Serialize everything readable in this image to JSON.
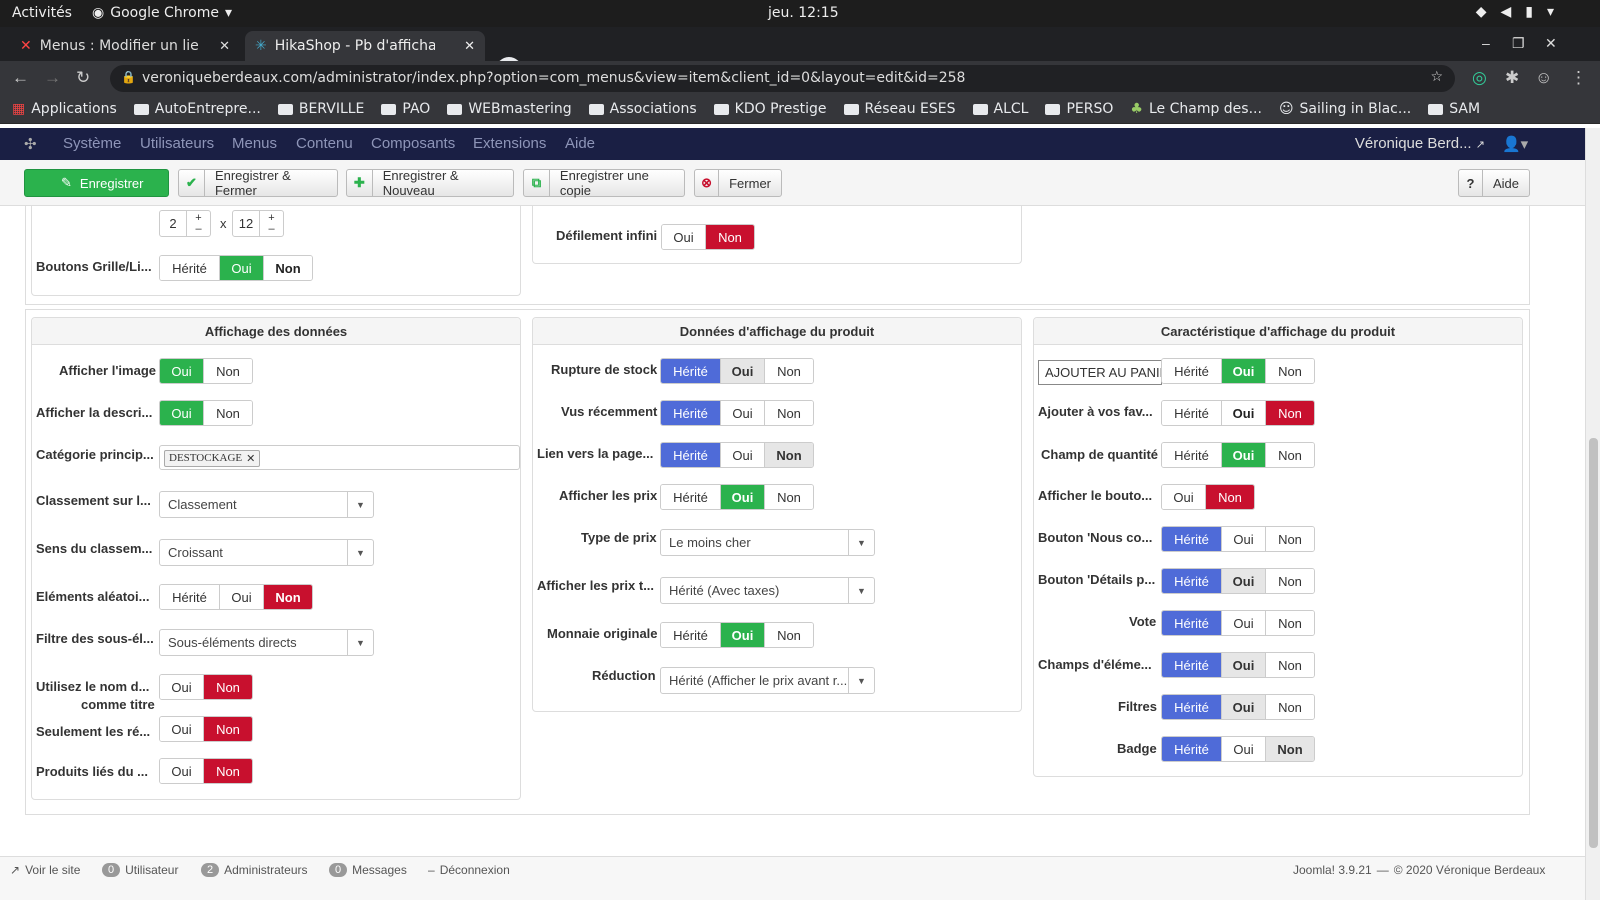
{
  "os": {
    "activities": "Activités",
    "app": "Google Chrome",
    "clock": "jeu. 12:15"
  },
  "browser": {
    "tabs": [
      {
        "title": "Menus : Modifier un lien d"
      },
      {
        "title": "HikaShop - Pb d'affichage"
      }
    ],
    "url": "veroniqueberdeaux.com/administrator/index.php?option=com_menus&view=item&client_id=0&layout=edit&id=258",
    "bookmarks": [
      "Applications",
      "AutoEntrepre...",
      "BERVILLE",
      "PAO",
      "WEBmastering",
      "Associations",
      "KDO Prestige",
      "Réseau ESES",
      "ALCL",
      "PERSO",
      "Le Champ des...",
      "Sailing in Blac...",
      "SAM"
    ]
  },
  "joomla_nav": {
    "menu": [
      "Système",
      "Utilisateurs",
      "Menus",
      "Contenu",
      "Composants",
      "Extensions",
      "Aide"
    ],
    "user": "Véronique Berd..."
  },
  "toolbar": {
    "save": "Enregistrer",
    "save_close": "Enregistrer & Fermer",
    "save_new": "Enregistrer & Nouveau",
    "save_copy": "Enregistrer une copie",
    "close": "Fermer",
    "help": "Aide"
  },
  "top": {
    "grid_cols": "2",
    "grid_rows": "12",
    "x": "x",
    "buttons_label": "Boutons Grille/Li...",
    "buttons_opts": [
      "Hérité",
      "Oui",
      "Non"
    ],
    "infinite_label": "Défilement infini",
    "infinite_opts": [
      "Oui",
      "Non"
    ]
  },
  "panel1": {
    "title": "Affichage des données",
    "show_image": "Afficher l'image",
    "show_desc": "Afficher la descri...",
    "main_cat": "Catégorie princip...",
    "main_cat_tag": "DESTOCKAGE",
    "sort_on": "Classement sur l...",
    "sort_on_val": "Classement",
    "sort_dir": "Sens du classem...",
    "sort_dir_val": "Croissant",
    "random": "Eléments aléatoi...",
    "filter": "Filtre des sous-él...",
    "filter_val": "Sous-éléments directs",
    "use_name1": "Utilisez le nom d...",
    "use_name2": "comme titre",
    "only": "Seulement les ré...",
    "related": "Produits liés du ...",
    "oui": "Oui",
    "non": "Non",
    "herite": "Hérité"
  },
  "panel2": {
    "title": "Données d'affichage du produit",
    "stock": "Rupture de stock",
    "recent": "Vus récemment",
    "link": "Lien vers la page...",
    "show_price": "Afficher les prix",
    "price_type": "Type de prix",
    "price_type_val": "Le moins cher",
    "show_prices_t": "Afficher les prix t...",
    "show_prices_t_val": "Hérité (Avec taxes)",
    "orig_currency": "Monnaie originale",
    "discount": "Réduction",
    "discount_val": "Hérité (Afficher le prix avant r..."
  },
  "panel3": {
    "title": "Caractéristique d'affichage du produit",
    "cart_input": "AJOUTER AU PANIER",
    "wishlist": "Ajouter à vos fav...",
    "qty": "Champ de quantité",
    "show_btn": "Afficher le bouto...",
    "contact": "Bouton 'Nous co...",
    "details": "Bouton 'Détails p...",
    "vote": "Vote",
    "fields": "Champs d'éléme...",
    "filters": "Filtres",
    "badge": "Badge"
  },
  "status": {
    "view_site": "Voir le site",
    "users_count": "0",
    "users": "Utilisateur",
    "admins_count": "2",
    "admins": "Administrateurs",
    "msg_count": "0",
    "messages": "Messages",
    "logout": "Déconnexion",
    "version": "Joomla! 3.9.21",
    "copyright": "© 2020 Véronique Berdeaux"
  },
  "colors": {
    "green": "#2bb24d",
    "red": "#c8102e",
    "blue": "#4f6bd8",
    "navbar": "#1a1f44"
  }
}
